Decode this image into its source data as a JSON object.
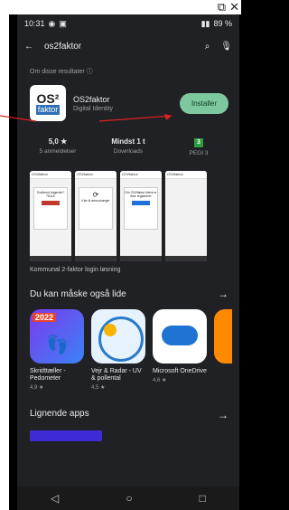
{
  "ext": {
    "open_icon": "open-external-icon",
    "close_icon": "close-icon"
  },
  "status": {
    "time": "10:31",
    "battery": "89 %"
  },
  "search": {
    "query": "os2faktor"
  },
  "about": "Om disse resultater",
  "app": {
    "icon_top": "OS²",
    "icon_bottom": "faktor",
    "name": "OS2faktor",
    "developer": "Digital Identity",
    "install": "Installer"
  },
  "stats": [
    {
      "value": "5,0 ★",
      "label": "5 anmeldelser"
    },
    {
      "value": "Mindst 1 t",
      "label": "Downloads"
    },
    {
      "value": "3",
      "label": "PEGI 3"
    }
  ],
  "screenshots": [
    {
      "header": "OS2faktor",
      "text": "Godkend fulgende?",
      "code": "75JLK"
    },
    {
      "header": "OS2faktor",
      "text": "Klar til anmodninger"
    },
    {
      "header": "OS2faktor",
      "text": "Din OS2faktor klient er ikke registreret"
    },
    {
      "header": "OS2faktor",
      "text": ""
    }
  ],
  "tagline": "Kommunal 2-faktor login løsning",
  "section_recommend": "Du kan måske også lide",
  "apps": [
    {
      "label": "Skridttæller - Pedometer",
      "rating": "4,9 ★",
      "badge": "2022"
    },
    {
      "label": "Vejr & Radar - UV & pollental",
      "rating": "4,5 ★"
    },
    {
      "label": "Microsoft OneDrive",
      "rating": "4,6 ★"
    }
  ],
  "section_similar": "Lignende apps"
}
